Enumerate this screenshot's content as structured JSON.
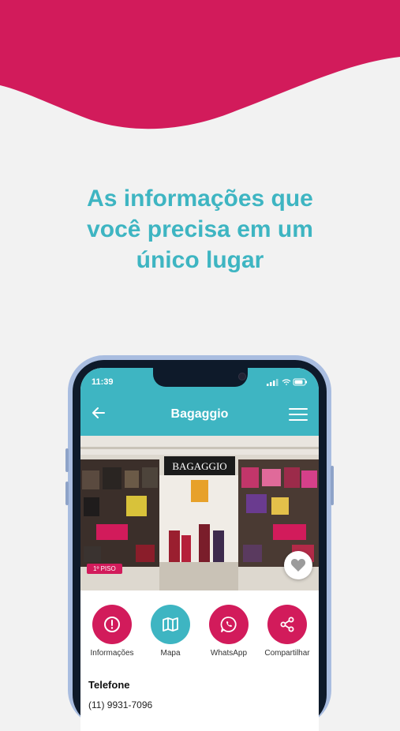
{
  "colors": {
    "brand_pink": "#d21b5b",
    "teal": "#3eb5c2",
    "background": "#f2f2f2"
  },
  "headline": "As informações que\nvocê precisa em um\núnico lugar",
  "phone": {
    "status_time": "11:39",
    "app_title": "Bagaggio",
    "store_sign": "BAGAGGIO",
    "floor_badge": "1º PISO",
    "actions": [
      {
        "label": "Informações",
        "icon": "info-icon",
        "color": "#d21b5b"
      },
      {
        "label": "Mapa",
        "icon": "map-icon",
        "color": "#3eb5c2"
      },
      {
        "label": "WhatsApp",
        "icon": "whatsapp-icon",
        "color": "#d21b5b"
      },
      {
        "label": "Compartilhar",
        "icon": "share-icon",
        "color": "#d21b5b"
      }
    ],
    "section_title": "Telefone",
    "phone_number": "(11) 9931-7096"
  }
}
